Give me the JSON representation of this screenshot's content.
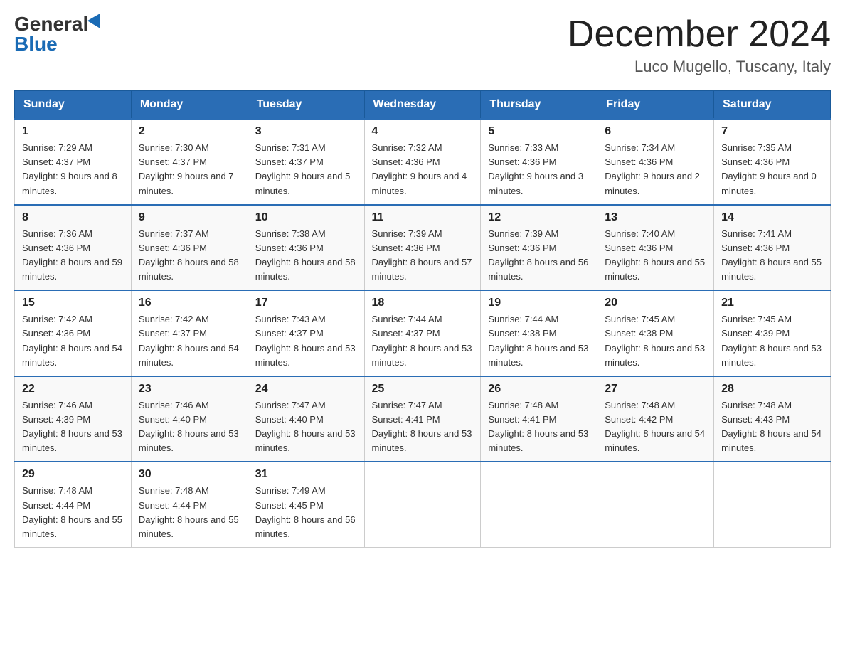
{
  "header": {
    "logo_general": "General",
    "logo_blue": "Blue",
    "title": "December 2024",
    "subtitle": "Luco Mugello, Tuscany, Italy"
  },
  "days_of_week": [
    "Sunday",
    "Monday",
    "Tuesday",
    "Wednesday",
    "Thursday",
    "Friday",
    "Saturday"
  ],
  "weeks": [
    [
      {
        "day": "1",
        "sunrise": "7:29 AM",
        "sunset": "4:37 PM",
        "daylight": "9 hours and 8 minutes."
      },
      {
        "day": "2",
        "sunrise": "7:30 AM",
        "sunset": "4:37 PM",
        "daylight": "9 hours and 7 minutes."
      },
      {
        "day": "3",
        "sunrise": "7:31 AM",
        "sunset": "4:37 PM",
        "daylight": "9 hours and 5 minutes."
      },
      {
        "day": "4",
        "sunrise": "7:32 AM",
        "sunset": "4:36 PM",
        "daylight": "9 hours and 4 minutes."
      },
      {
        "day": "5",
        "sunrise": "7:33 AM",
        "sunset": "4:36 PM",
        "daylight": "9 hours and 3 minutes."
      },
      {
        "day": "6",
        "sunrise": "7:34 AM",
        "sunset": "4:36 PM",
        "daylight": "9 hours and 2 minutes."
      },
      {
        "day": "7",
        "sunrise": "7:35 AM",
        "sunset": "4:36 PM",
        "daylight": "9 hours and 0 minutes."
      }
    ],
    [
      {
        "day": "8",
        "sunrise": "7:36 AM",
        "sunset": "4:36 PM",
        "daylight": "8 hours and 59 minutes."
      },
      {
        "day": "9",
        "sunrise": "7:37 AM",
        "sunset": "4:36 PM",
        "daylight": "8 hours and 58 minutes."
      },
      {
        "day": "10",
        "sunrise": "7:38 AM",
        "sunset": "4:36 PM",
        "daylight": "8 hours and 58 minutes."
      },
      {
        "day": "11",
        "sunrise": "7:39 AM",
        "sunset": "4:36 PM",
        "daylight": "8 hours and 57 minutes."
      },
      {
        "day": "12",
        "sunrise": "7:39 AM",
        "sunset": "4:36 PM",
        "daylight": "8 hours and 56 minutes."
      },
      {
        "day": "13",
        "sunrise": "7:40 AM",
        "sunset": "4:36 PM",
        "daylight": "8 hours and 55 minutes."
      },
      {
        "day": "14",
        "sunrise": "7:41 AM",
        "sunset": "4:36 PM",
        "daylight": "8 hours and 55 minutes."
      }
    ],
    [
      {
        "day": "15",
        "sunrise": "7:42 AM",
        "sunset": "4:36 PM",
        "daylight": "8 hours and 54 minutes."
      },
      {
        "day": "16",
        "sunrise": "7:42 AM",
        "sunset": "4:37 PM",
        "daylight": "8 hours and 54 minutes."
      },
      {
        "day": "17",
        "sunrise": "7:43 AM",
        "sunset": "4:37 PM",
        "daylight": "8 hours and 53 minutes."
      },
      {
        "day": "18",
        "sunrise": "7:44 AM",
        "sunset": "4:37 PM",
        "daylight": "8 hours and 53 minutes."
      },
      {
        "day": "19",
        "sunrise": "7:44 AM",
        "sunset": "4:38 PM",
        "daylight": "8 hours and 53 minutes."
      },
      {
        "day": "20",
        "sunrise": "7:45 AM",
        "sunset": "4:38 PM",
        "daylight": "8 hours and 53 minutes."
      },
      {
        "day": "21",
        "sunrise": "7:45 AM",
        "sunset": "4:39 PM",
        "daylight": "8 hours and 53 minutes."
      }
    ],
    [
      {
        "day": "22",
        "sunrise": "7:46 AM",
        "sunset": "4:39 PM",
        "daylight": "8 hours and 53 minutes."
      },
      {
        "day": "23",
        "sunrise": "7:46 AM",
        "sunset": "4:40 PM",
        "daylight": "8 hours and 53 minutes."
      },
      {
        "day": "24",
        "sunrise": "7:47 AM",
        "sunset": "4:40 PM",
        "daylight": "8 hours and 53 minutes."
      },
      {
        "day": "25",
        "sunrise": "7:47 AM",
        "sunset": "4:41 PM",
        "daylight": "8 hours and 53 minutes."
      },
      {
        "day": "26",
        "sunrise": "7:48 AM",
        "sunset": "4:41 PM",
        "daylight": "8 hours and 53 minutes."
      },
      {
        "day": "27",
        "sunrise": "7:48 AM",
        "sunset": "4:42 PM",
        "daylight": "8 hours and 54 minutes."
      },
      {
        "day": "28",
        "sunrise": "7:48 AM",
        "sunset": "4:43 PM",
        "daylight": "8 hours and 54 minutes."
      }
    ],
    [
      {
        "day": "29",
        "sunrise": "7:48 AM",
        "sunset": "4:44 PM",
        "daylight": "8 hours and 55 minutes."
      },
      {
        "day": "30",
        "sunrise": "7:48 AM",
        "sunset": "4:44 PM",
        "daylight": "8 hours and 55 minutes."
      },
      {
        "day": "31",
        "sunrise": "7:49 AM",
        "sunset": "4:45 PM",
        "daylight": "8 hours and 56 minutes."
      },
      null,
      null,
      null,
      null
    ]
  ]
}
